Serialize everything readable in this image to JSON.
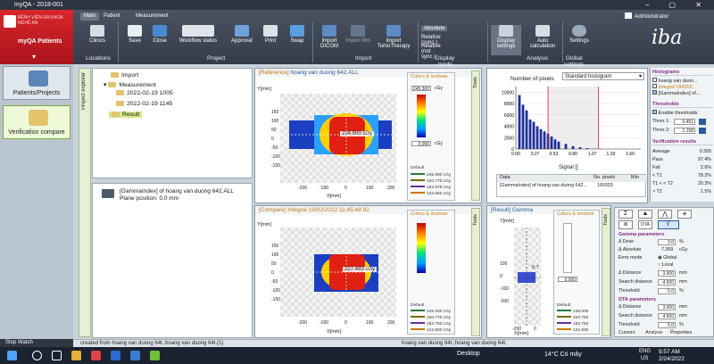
{
  "window": {
    "title": "myQA - 2018-001",
    "controls": "–  ▢  ✕"
  },
  "app_menu": {
    "name": "myQA Patients",
    "watermark": "BỆNH VIỆN ĐA KHOA NGHỆ AN"
  },
  "ribbon": {
    "tabs": [
      "Main",
      "Patient",
      "Measurement"
    ],
    "buttons": [
      "Clinics",
      "Save",
      "Close",
      "Workflow status",
      "Approval",
      "Print",
      "Swap",
      "Import DICOM",
      "Import film",
      "Import TomoTherapy",
      "Display settings",
      "Auto calculation",
      "Settings"
    ],
    "display_mode": [
      "Absolute",
      "Relative (sync.)",
      "Relative (not sync.)"
    ],
    "groups": [
      "Locations",
      "Project",
      "Import",
      "Display mode",
      "Analysis",
      "Global settings"
    ],
    "user": "Administrator",
    "brand": "iba"
  },
  "sidebar": {
    "items": [
      "Patients/Projects",
      "Verification compare"
    ],
    "explorer_label": "Project explorer"
  },
  "tree": {
    "nodes": [
      "Import",
      "Measurement",
      "2022-02-19 1005",
      "2022-02-19 1145",
      "Result"
    ]
  },
  "detail": {
    "title": "[GammaIndex] of hoang van duong 642.ALL",
    "plane": "Plane position: 0.0 mm"
  },
  "reference": {
    "tag": "[Reference]",
    "name": "hoang van duong 642.ALL",
    "readout": "224.900 cGy",
    "ylabel": "Y[mm]",
    "xlabel": "X[mm]",
    "xticks": [
      "-200",
      "-100",
      "0",
      "100",
      "200"
    ],
    "yticks": [
      "150",
      "100",
      "50",
      "0",
      "-50",
      "-100",
      "-150"
    ],
    "iso_title": "Colors & isodose",
    "iso_max": "245.300",
    "iso_min": "0.000",
    "unit": "cGy",
    "iso_default": "Default",
    "iso_levels": [
      "245.300 cGy",
      "220.770 cGy",
      "183.975 cGy",
      "122.650 cGy"
    ]
  },
  "compare": {
    "tag": "[Compare]",
    "name": "Integral 19/02/2022 11:45:48.92",
    "readout": "227.493 cGy",
    "ylabel": "Y[mm]",
    "xlabel": "X[mm]",
    "xticks": [
      "-200",
      "-100",
      "0",
      "100",
      "200"
    ],
    "yticks": [
      "150",
      "100",
      "50",
      "0",
      "-50",
      "-100",
      "-150"
    ],
    "iso_title": "Colors & isodose",
    "iso_default": "Default",
    "iso_levels": [
      "245.000 cGy",
      "220.770 cGy",
      "183.750 cGy",
      "122.500 cGy"
    ]
  },
  "result": {
    "tag": "[Result]",
    "name": "Gamma",
    "iso_title": "Colors & isodose",
    "iso_min": "0.000",
    "iso_default": "Default",
    "iso_levels": [
      "245.000",
      "220.750",
      "183.750",
      "122.500"
    ],
    "readout": "0.7",
    "ylabel": "Y[mm]",
    "xlabel": "X[mm]",
    "yticks": [
      "100",
      "0",
      "-100",
      "-200"
    ],
    "xticks": [
      "-200",
      "0"
    ]
  },
  "histogram": {
    "ylabel": "Number of pixels",
    "xlabel": "Signal []",
    "selector": "Standard histogram",
    "columns": [
      "Data",
      "No. pixels",
      "Min"
    ],
    "row": [
      "[GammaIndex] of hoang van duong 642...",
      "169333",
      ""
    ]
  },
  "chart_data": {
    "type": "bar",
    "x": [
      0.05,
      0.1,
      0.15,
      0.2,
      0.25,
      0.3,
      0.35,
      0.4,
      0.45,
      0.5,
      0.55,
      0.6,
      0.7,
      0.8,
      0.9,
      1.0,
      1.1
    ],
    "values": [
      9500,
      7800,
      6800,
      5200,
      4800,
      4000,
      3500,
      3100,
      2700,
      2200,
      1700,
      1300,
      900,
      500,
      300,
      150,
      50
    ],
    "ylabel": "Number of pixels",
    "xlabel": "Signal []",
    "xticks": [
      "0.00",
      "0.27",
      "0.53",
      "0.80",
      "1.07",
      "1.33",
      "1.60"
    ],
    "yticks": [
      "10000",
      "8000",
      "6000",
      "4000",
      "2000",
      "0"
    ],
    "ylim": [
      0,
      11000
    ],
    "xlim": [
      0,
      1.75
    ]
  },
  "right_panel": {
    "histograms_title": "Histograms",
    "histograms": [
      "hoang van duon...",
      "Integral 19/02/2...",
      "[GammaIndex] of..."
    ],
    "thresholds_title": "Thresholds",
    "enable": "Enable thresholds",
    "thres1_label": "Thres 1:",
    "thres1": "0.451",
    "thres2_label": "Thres 2:",
    "thres2": "1.158",
    "stats_title": "Verification results",
    "stats": [
      [
        "Average",
        "0.305"
      ],
      [
        "Pass",
        "97.4%"
      ],
      [
        "Fail",
        "2.6%"
      ],
      [
        "< T1",
        "78.2%"
      ],
      [
        "T1 < < T2",
        "20.3%"
      ],
      [
        "> T2",
        "1.5%"
      ]
    ]
  },
  "gamma": {
    "icons": [
      "Σ",
      "▲",
      "⋀",
      "✳",
      "⊛",
      "DTA",
      "γ'"
    ],
    "section": "Gamma parameters",
    "rows": [
      [
        "Δ Dose",
        "3.0",
        "%"
      ],
      [
        "Δ Absolute",
        "7.359",
        "cGy"
      ],
      [
        "Δ Distance",
        "3.000",
        "mm"
      ],
      [
        "Search distance",
        "4.500",
        "mm"
      ],
      [
        "Threshold",
        "5.0",
        "%"
      ]
    ],
    "error_mode": "Error mode",
    "modes": [
      "Global",
      "Local"
    ],
    "dta_section": "DTA parameters",
    "dta_rows": [
      [
        "Δ Distance",
        "3.000",
        "mm"
      ],
      [
        "Search distance",
        "4.500",
        "mm"
      ],
      [
        "Threshold",
        "5.0",
        "%"
      ]
    ],
    "tabs": [
      "Cursors",
      "Analysis",
      "Properties"
    ]
  },
  "status": {
    "stopwatch": "Stop Watch",
    "left": "created from hoang van duong 64t.;hoang van duong 64t.(1)",
    "right": "hoang van duong 64t.;hoang van duong 64t."
  },
  "taskbar": {
    "desktop": "Desktop",
    "weather": "14°C  Có mây",
    "lang": "ENG",
    "region": "US",
    "time": "9:57 AM",
    "date": "2/24/2022"
  },
  "tools_label": "Tools"
}
